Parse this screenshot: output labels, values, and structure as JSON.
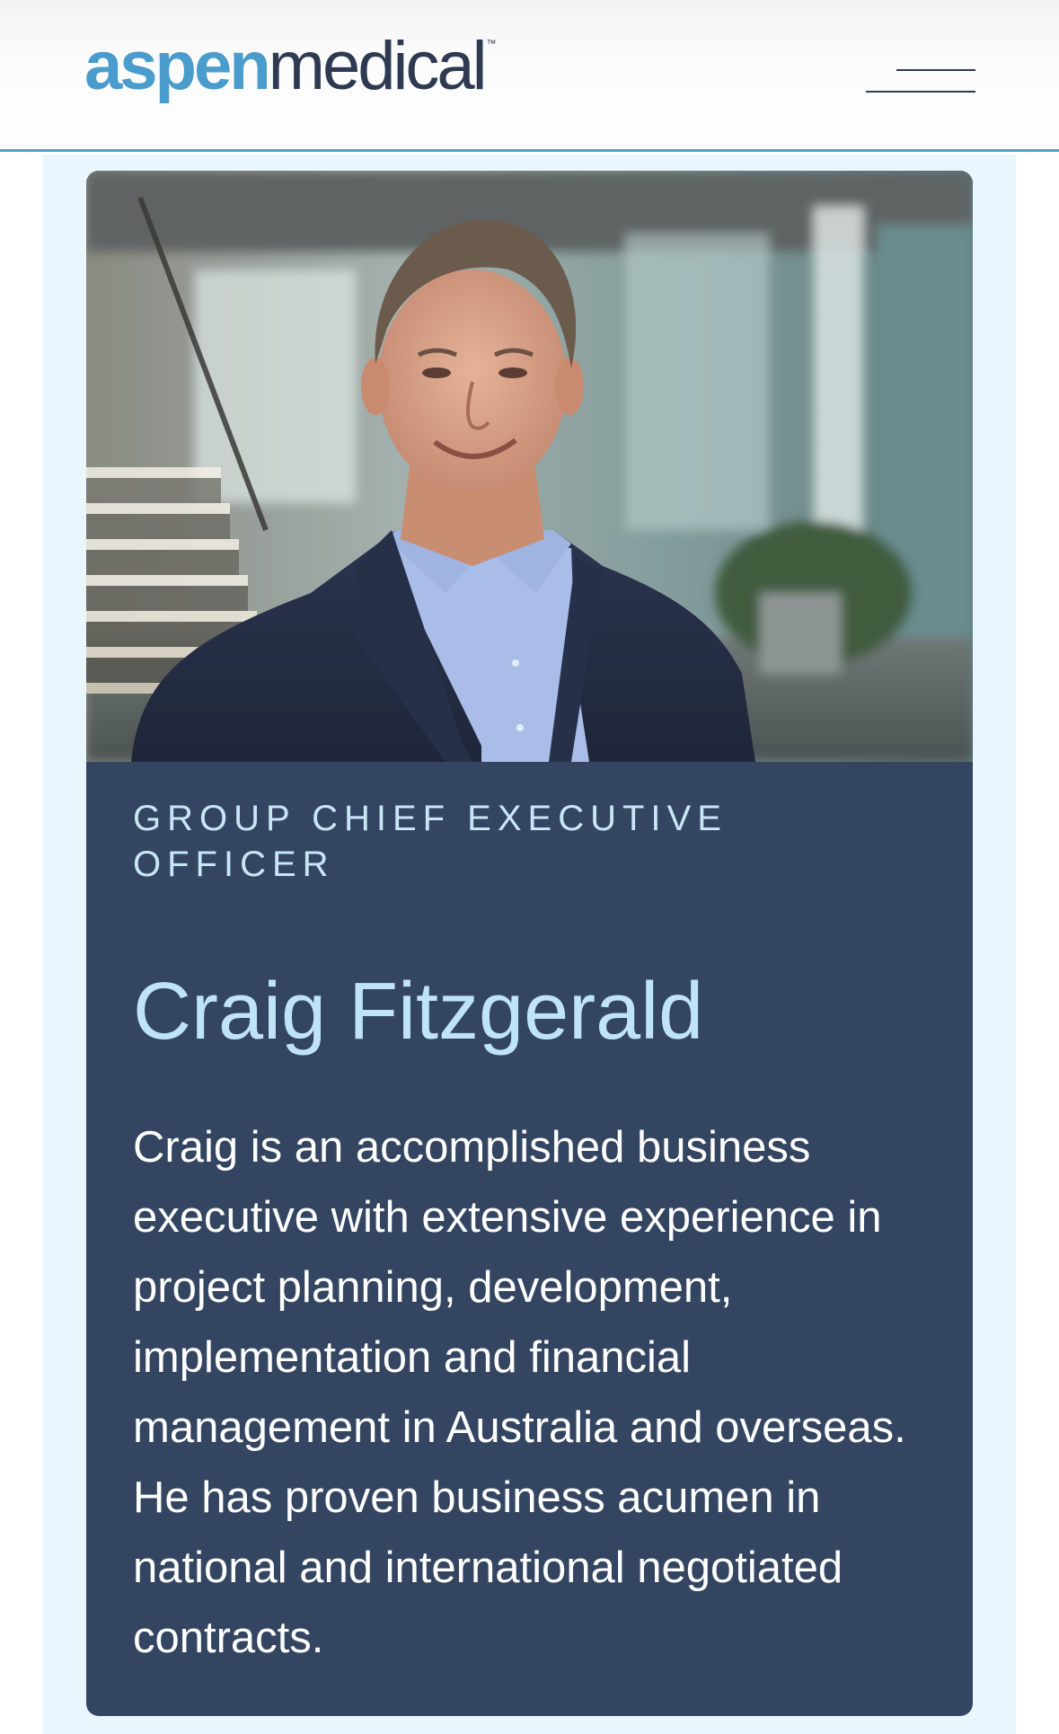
{
  "header": {
    "logo_primary": "aspen",
    "logo_secondary": "medical",
    "logo_mark": "™",
    "menu_icon": "hamburger-menu-icon"
  },
  "profile": {
    "photo_alt": "Craig Fitzgerald",
    "role": "Group Chief Executive Officer",
    "name": "Craig Fitzgerald",
    "bio": "Craig is an accomplished business executive with extensive experience in project planning, development, implementation and financial management in Australia and overseas. He has proven business acumen in national and international negotiated contracts."
  },
  "colors": {
    "brand_blue": "#4a9ccd",
    "brand_navy": "#2d3a52",
    "card_background": "#334560",
    "accent_light_blue": "#bfe3f7",
    "page_tint": "#eaf6fd"
  }
}
